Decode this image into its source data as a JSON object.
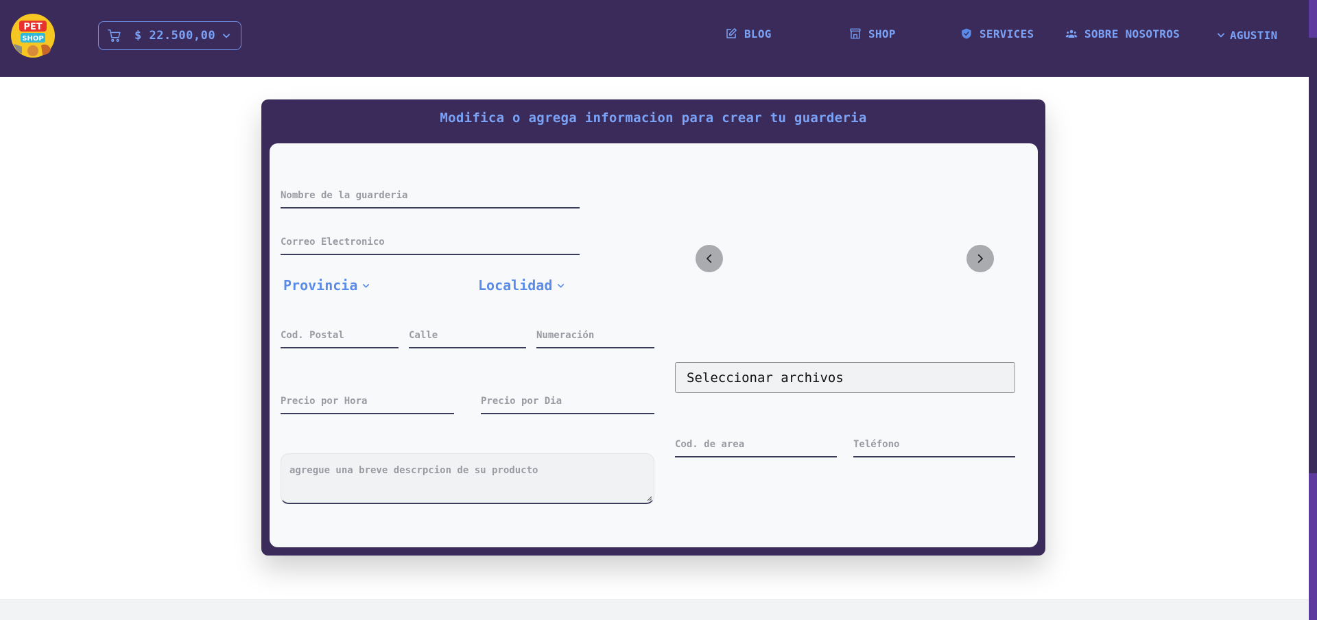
{
  "header": {
    "logo": {
      "text_top": "PET",
      "text_bottom": "SHOP"
    },
    "cart": {
      "amount": "$ 22.500,00",
      "icon": "cart-icon"
    },
    "nav": [
      {
        "label": "BLOG",
        "icon": "edit-icon"
      },
      {
        "label": "SHOP",
        "icon": "store-icon"
      },
      {
        "label": "SERVICES",
        "icon": "shield-icon"
      },
      {
        "label": "SOBRE NOSOTROS",
        "icon": "group-icon"
      }
    ],
    "user": {
      "label": "AGUSTIN",
      "icon": "chevron-down-icon"
    }
  },
  "form": {
    "title": "Modifica o agrega informacion para crear tu guarderia",
    "fields": {
      "nombre": "Nombre de la guarderia",
      "correo": "Correo Electronico",
      "cod_postal": "Cod. Postal",
      "calle": "Calle",
      "numeracion": "Numeración",
      "precio_hora": "Precio por Hora",
      "precio_dia": "Precio por Dia",
      "cod_area": "Cod. de area",
      "telefono": "Teléfono"
    },
    "selects": {
      "provincia": "Provincia",
      "localidad": "Localidad"
    },
    "descripcion_placeholder": "agregue una breve descrpcion de su producto",
    "file_button": "Seleccionar archivos"
  },
  "colors": {
    "header_bg": "#3b2b5a",
    "accent": "#7aa2f7",
    "panel_inner_bg": "#f8f9fb"
  }
}
